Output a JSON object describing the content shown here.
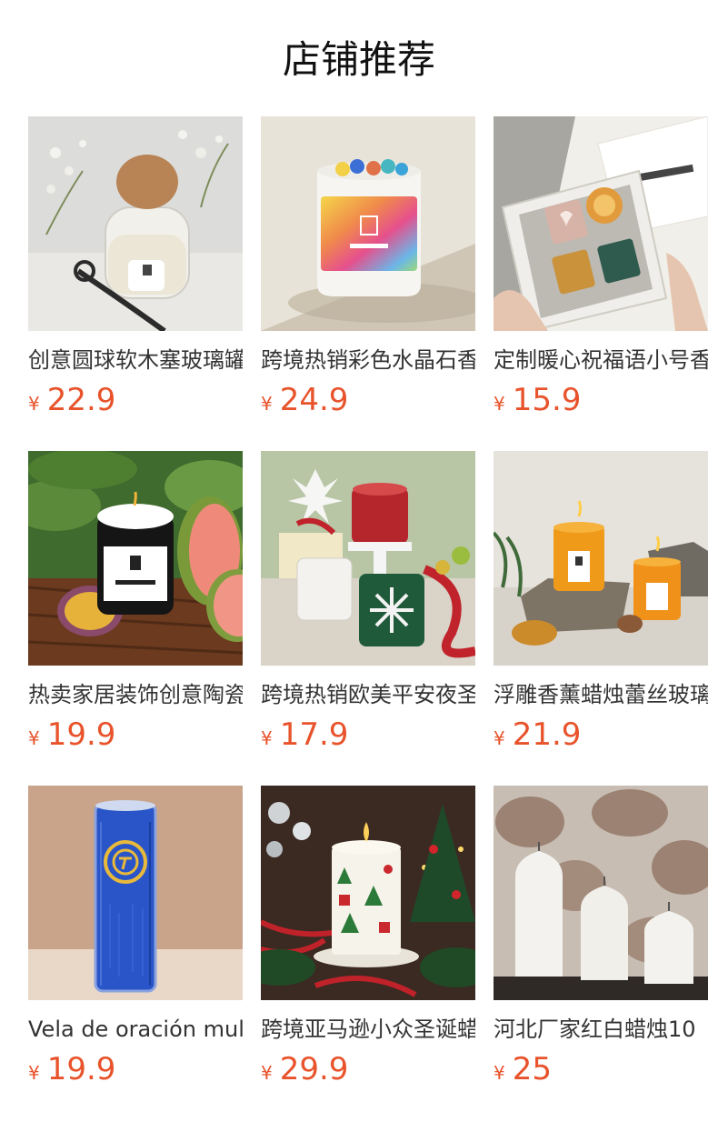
{
  "header": {
    "title": "店铺推荐"
  },
  "products": [
    {
      "name": "创意圆球软木塞玻璃罐香薰蜡烛",
      "currency": "¥",
      "price": "22.9",
      "image_icon": "cork-jar-candle-photo"
    },
    {
      "name": "跨境热销彩色水晶石香薰蜡烛",
      "currency": "¥",
      "price": "24.9",
      "image_icon": "crystal-candle-photo"
    },
    {
      "name": "定制暖心祝福语小号香薰蜡烛礼盒",
      "currency": "¥",
      "price": "15.9",
      "image_icon": "candle-gift-box-photo"
    },
    {
      "name": "热卖家居装饰创意陶瓷香薰蜡烛",
      "currency": "¥",
      "price": "19.9",
      "image_icon": "black-jar-candle-photo"
    },
    {
      "name": "跨境热销欧美平安夜圣诞蜡烛",
      "currency": "¥",
      "price": "17.9",
      "image_icon": "christmas-candles-photo"
    },
    {
      "name": "浮雕香薰蜡烛蕾丝玻璃杯",
      "currency": "¥",
      "price": "21.9",
      "image_icon": "amber-glass-candles-photo"
    },
    {
      "name": "Vela de oración multicolor",
      "currency": "¥",
      "price": "19.9",
      "image_icon": "blue-prayer-candle-photo"
    },
    {
      "name": "跨境亚马逊小众圣诞蜡烛",
      "currency": "¥",
      "price": "29.9",
      "image_icon": "christmas-pillar-candle-photo"
    },
    {
      "name": "河北厂家红白蜡烛10",
      "currency": "¥",
      "price": "25",
      "image_icon": "white-pillar-candles-photo"
    }
  ],
  "colors": {
    "price": "#e8532b",
    "title": "#111111",
    "text": "#333333"
  }
}
